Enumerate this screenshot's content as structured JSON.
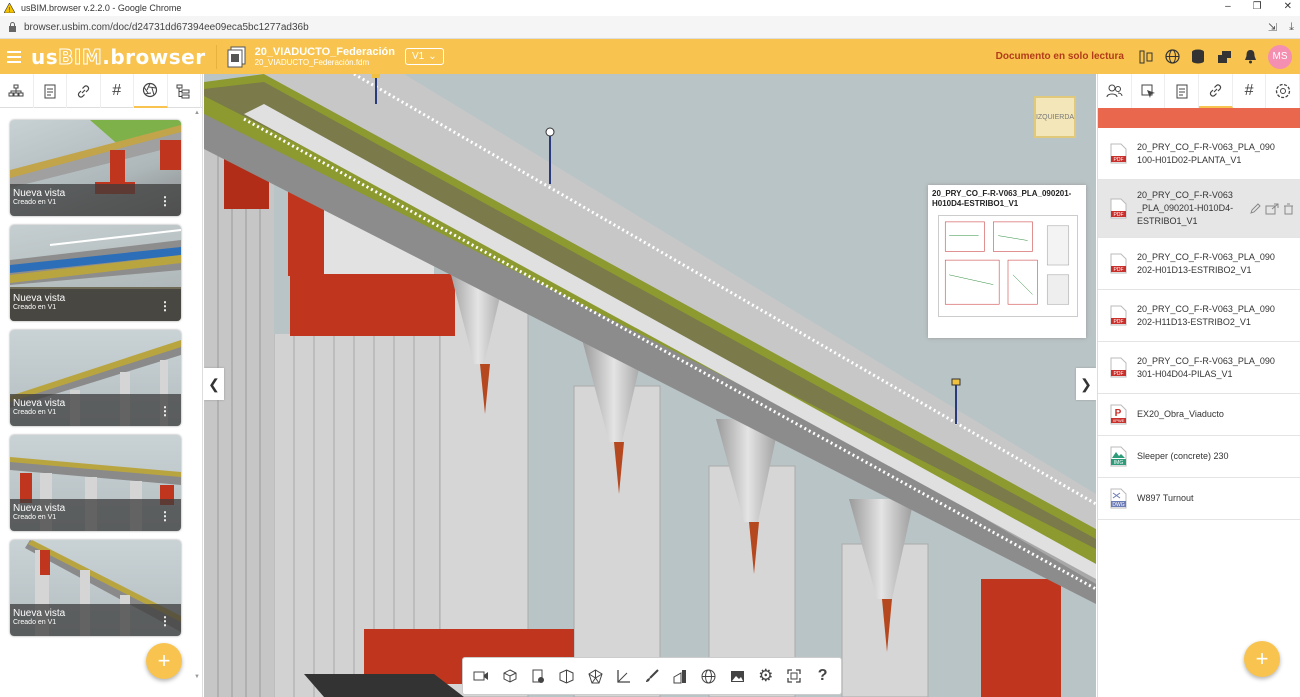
{
  "browser": {
    "window_title": "usBIM.browser v.2.2.0 - Google Chrome",
    "url": "browser.usbim.com/doc/d24731dd67394ee09eca5bc1277ad36b"
  },
  "header": {
    "logo_us": "us",
    "logo_bim": "BIM",
    "logo_rest": ".browser",
    "doc_title": "20_VIADUCTO_Federación",
    "doc_file": "20_VIADUCTO_Federación.fdm",
    "version": "V1",
    "readonly": "Documento en solo lectura",
    "avatar": "MS"
  },
  "left_panel": {
    "views": [
      {
        "name": "Nueva vista",
        "sub": "Creado en V1"
      },
      {
        "name": "Nueva vista",
        "sub": "Creado en V1"
      },
      {
        "name": "Nueva vista",
        "sub": "Creado en V1"
      },
      {
        "name": "Nueva vista",
        "sub": "Creado en V1"
      },
      {
        "name": "Nueva vista",
        "sub": "Creado en V1"
      }
    ],
    "fab": "+"
  },
  "viewport": {
    "cube_label": "IZQUIERDA",
    "popup_title": "20_PRY_CO_F-R-V063_PLA_090201-H010D4-ESTRIBO1_V1"
  },
  "right_panel": {
    "files": [
      {
        "name": "20_PRY_CO_F-R-V063_PLA_090100-H01D02-PLANTA_V1",
        "type": "PDF"
      },
      {
        "name": "20_PRY_CO_F-R-V063_PLA_090201-H010D4-ESTRIBO1_V1",
        "type": "PDF"
      },
      {
        "name": "20_PRY_CO_F-R-V063_PLA_090202-H01D13-ESTRIBO2_V1",
        "type": "PDF"
      },
      {
        "name": "20_PRY_CO_F-R-V063_PLA_090202-H11D13-ESTRIBO2_V1",
        "type": "PDF"
      },
      {
        "name": "20_PRY_CO_F-R-V063_PLA_090301-H04D04-PILAS_V1",
        "type": "PDF"
      },
      {
        "name": "EX20_Obra_Viaducto",
        "type": "XPWE"
      },
      {
        "name": "Sleeper (concrete) 230",
        "type": "IMG"
      },
      {
        "name": "W897 Turnout",
        "type": "DWG"
      }
    ],
    "fab": "+"
  },
  "colors": {
    "accent": "#f8c44f",
    "readonly_text": "#b33b1a",
    "red_bar": "#e8674d"
  }
}
